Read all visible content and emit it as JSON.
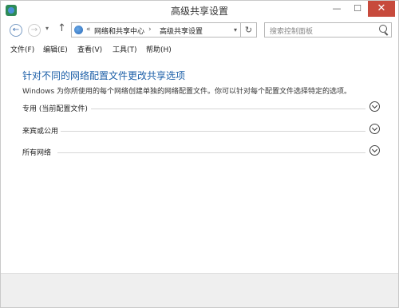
{
  "window": {
    "title": "高级共享设置",
    "min_glyph": "—",
    "max_glyph": "☐",
    "close_glyph": "✕"
  },
  "nav": {
    "back_glyph": "←",
    "forward_glyph": "→",
    "dropdown_glyph": "▾",
    "up_glyph": "↑",
    "address_chevron": "«",
    "breadcrumb_1": "网络和共享中心",
    "breadcrumb_separator": "›",
    "breadcrumb_2": "高级共享设置",
    "address_dropdown_glyph": "▾",
    "refresh_glyph": "↻",
    "search_placeholder": "搜索控制面板"
  },
  "menu": {
    "items": [
      "文件(F)",
      "编辑(E)",
      "查看(V)",
      "工具(T)",
      "帮助(H)"
    ]
  },
  "content": {
    "heading": "针对不同的网络配置文件更改共享选项",
    "description": "Windows 为你所使用的每个网络创建单独的网络配置文件。你可以针对每个配置文件选择特定的选项。",
    "sections": [
      {
        "label": "专用 (当前配置文件)"
      },
      {
        "label": "来宾或公用"
      },
      {
        "label": "所有网络"
      }
    ]
  },
  "colors": {
    "heading": "#1c5fa8",
    "close_button": "#c74a3c"
  }
}
